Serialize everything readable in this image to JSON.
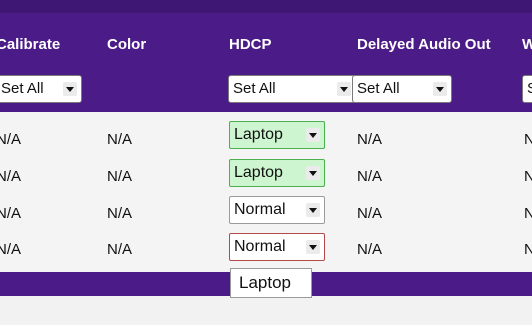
{
  "table": {
    "headers": {
      "calibrate": "Calibrate",
      "color": "Color",
      "hdcp": "HDCP",
      "delayed_audio_out": "Delayed Audio Out",
      "next_col_initial": "W"
    },
    "set_all": {
      "calibrate": "Set All",
      "hdcp": "Set All",
      "delayed_audio": "Set All",
      "next_col_partial": "S"
    },
    "rows": [
      {
        "calibrate": "N/A",
        "color": "N/A",
        "hdcp": "Laptop",
        "delayed_audio": "N/A",
        "next_partial": "N"
      },
      {
        "calibrate": "N/A",
        "color": "N/A",
        "hdcp": "Laptop",
        "delayed_audio": "N/A",
        "next_partial": "N"
      },
      {
        "calibrate": "N/A",
        "color": "N/A",
        "hdcp": "Normal",
        "delayed_audio": "N/A",
        "next_partial": "N"
      },
      {
        "calibrate": "N/A",
        "color": "N/A",
        "hdcp": "Normal",
        "delayed_audio": "N/A",
        "next_partial": "N"
      }
    ]
  },
  "dropdown_popup": {
    "options": [
      "Laptop"
    ]
  },
  "colors": {
    "header_bg": "#4b1c87",
    "selected_bg": "#cdf5cf",
    "selected_border": "#4caf50"
  }
}
